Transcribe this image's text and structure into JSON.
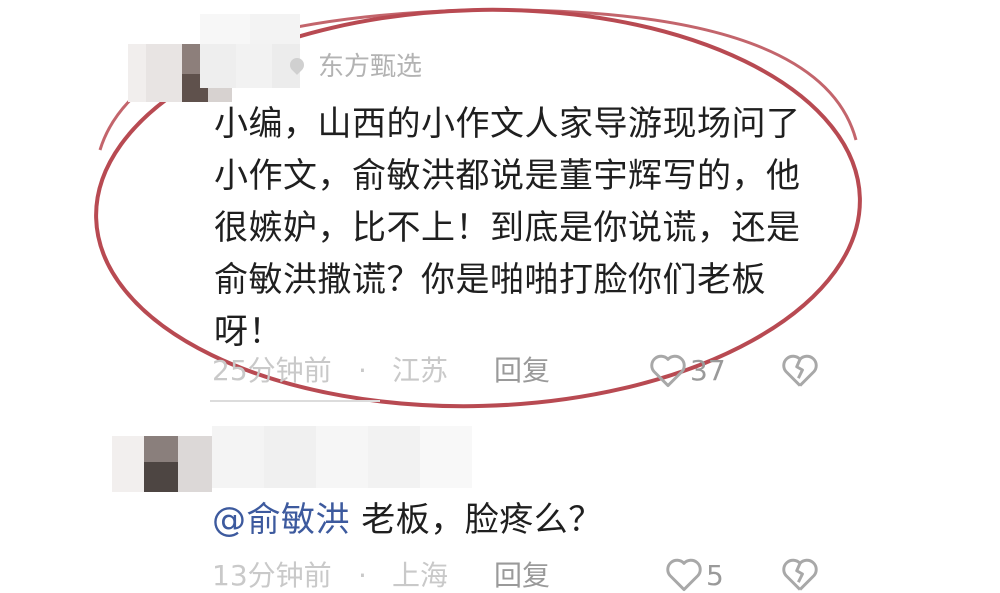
{
  "comment1": {
    "source": "东方甄选",
    "lines": [
      "小编，山西的小作文人家导游现场问了",
      "小作文，俞敏洪都说是董宇辉写的，他",
      "很嫉妒，比不上！到底是你说谎，还是",
      "俞敏洪撒谎？你是啪啪打脸你们老板",
      "呀！"
    ],
    "time": "25分钟前",
    "dot": "·",
    "location": "江苏",
    "reply": "回复",
    "likes": "37"
  },
  "comment2": {
    "mention": "@俞敏洪",
    "text": " 老板，脸疼么？",
    "time": "13分钟前",
    "dot": "·",
    "location": "上海",
    "reply": "回复",
    "likes": "5"
  },
  "colors": {
    "highlight_ellipse": "#b84a52",
    "mention": "#3d5a9e",
    "meta_gray": "#b0b0b0"
  },
  "icons": {
    "like": "heart-outline-icon",
    "dislike": "broken-heart-icon",
    "location": "pin-icon"
  }
}
